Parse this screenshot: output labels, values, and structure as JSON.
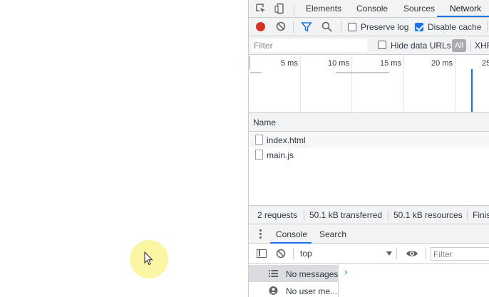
{
  "devtools": {
    "tabs": [
      {
        "label": "Elements"
      },
      {
        "label": "Console"
      },
      {
        "label": "Sources"
      },
      {
        "label": "Network",
        "active": true
      }
    ],
    "toolbar": {
      "preserve_log_label": "Preserve log",
      "preserve_log_checked": false,
      "disable_cache_label": "Disable cache",
      "disable_cache_checked": true
    },
    "filterbar": {
      "filter_placeholder": "Filter",
      "hide_data_urls_label": "Hide data URLs",
      "hide_data_urls_checked": false,
      "all_label": "All",
      "xhr_label": "XHR"
    },
    "overview": {
      "ticks": [
        "5 ms",
        "10 ms",
        "15 ms",
        "20 ms",
        "25"
      ]
    },
    "network_table": {
      "column_name": "Name",
      "rows": [
        {
          "name": "index.html"
        },
        {
          "name": "main.js"
        }
      ]
    },
    "status_bar": {
      "requests": "2 requests",
      "transferred": "50.1 kB transferred",
      "resources": "50.1 kB resources",
      "finish": "Finis"
    },
    "drawer": {
      "tabs": [
        {
          "label": "Console",
          "active": true
        },
        {
          "label": "Search"
        }
      ],
      "context_value": "top",
      "filter_placeholder": "Filter",
      "sidebar": [
        {
          "label": "No messages",
          "icon": "list-icon",
          "selected": true
        },
        {
          "label": "No user me...",
          "icon": "user-icon"
        }
      ],
      "prompt_symbol": "›"
    }
  },
  "colors": {
    "accent": "#1a73e8",
    "record": "#d93025",
    "cursor_highlight": "#fbf59a"
  }
}
